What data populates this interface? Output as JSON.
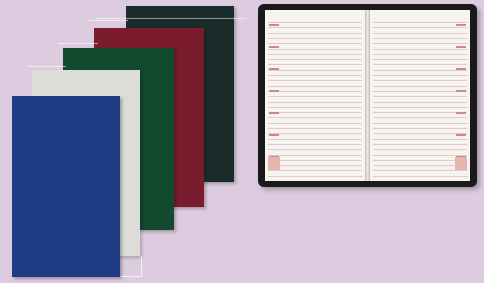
{
  "image": {
    "subject": "diaries",
    "background_color": "#ddcbe0"
  },
  "covers": [
    {
      "name": "black",
      "color": "#1b2d2a"
    },
    {
      "name": "red",
      "color": "#7a1c2e"
    },
    {
      "name": "green",
      "color": "#13492e"
    },
    {
      "name": "white",
      "color": "#dcdcd8"
    },
    {
      "name": "blue",
      "color": "#1f3b84"
    }
  ],
  "open_diary": {
    "left_header": "",
    "right_header": "",
    "accent_color": "#c98a8a"
  }
}
